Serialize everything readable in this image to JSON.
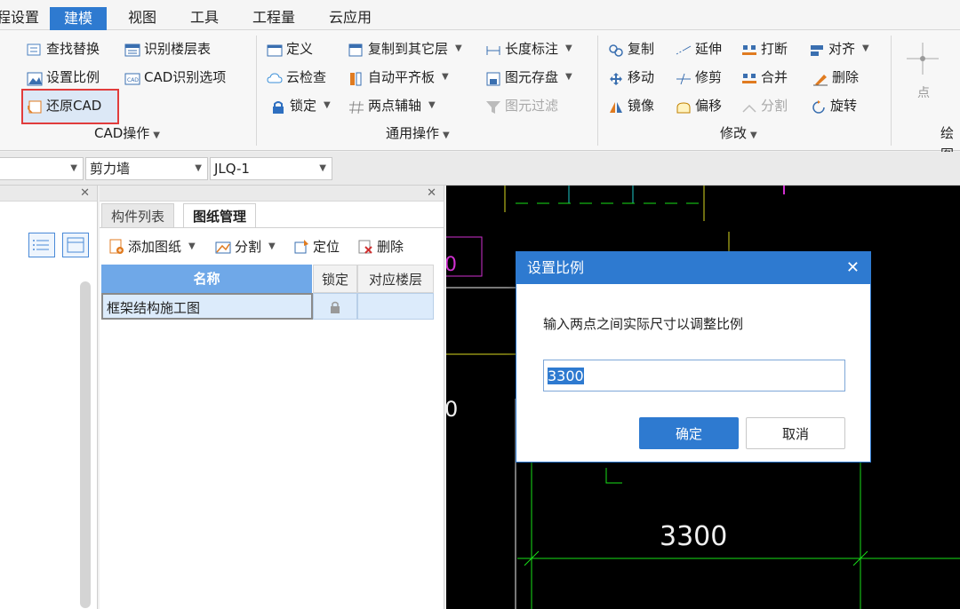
{
  "menu": {
    "tabs": [
      {
        "label": "程设置",
        "active": false
      },
      {
        "label": "建模",
        "active": true
      },
      {
        "label": "视图",
        "active": false
      },
      {
        "label": "工具",
        "active": false
      },
      {
        "label": "工程量",
        "active": false
      },
      {
        "label": "云应用",
        "active": false
      }
    ]
  },
  "ribbon": {
    "cad": {
      "find_replace": "查找替换",
      "identify_floor_table": "识别楼层表",
      "set_scale": "设置比例",
      "cad_identify_options": "CAD识别选项",
      "restore_cad": "还原CAD",
      "group_label": "CAD操作"
    },
    "general": {
      "define": "定义",
      "copy_to_floor": "复制到其它层",
      "length_dim": "长度标注",
      "cloud_check": "云检查",
      "auto_level": "自动平齐板",
      "element_save": "图元存盘",
      "lock": "锁定",
      "two_point_axis": "两点辅轴",
      "element_filter": "图元过滤",
      "group_label": "通用操作"
    },
    "modify": {
      "copy": "复制",
      "extend": "延伸",
      "break": "打断",
      "align": "对齐",
      "move": "移动",
      "trim": "修剪",
      "merge": "合并",
      "delete": "删除",
      "mirror": "镜像",
      "offset": "偏移",
      "split": "分割",
      "rotate": "旋转",
      "group_label": "修改"
    },
    "draw": {
      "point": "点",
      "group_label": "绘图"
    }
  },
  "selectors": {
    "type": "剪力墙",
    "component": "JLQ-1"
  },
  "drawing_panel": {
    "tabs": [
      {
        "label": "构件列表",
        "active": false
      },
      {
        "label": "图纸管理",
        "active": true
      }
    ],
    "toolbar": {
      "add": "添加图纸",
      "split": "分割",
      "locate": "定位",
      "delete": "删除"
    },
    "columns": [
      "名称",
      "锁定",
      "对应楼层"
    ],
    "rows": [
      {
        "name": "框架结构施工图",
        "lock": "locked",
        "floor": ""
      }
    ]
  },
  "cad": {
    "dimension_text": "3300",
    "colors": {
      "green": "#19e019",
      "cyan": "#1ec8c8",
      "magenta": "#d030d0",
      "yellow": "#d8d820",
      "white": "#f0f0f0"
    }
  },
  "dialog": {
    "title": "设置比例",
    "message": "输入两点之间实际尺寸以调整比例",
    "value": "3300",
    "ok": "确定",
    "cancel": "取消"
  },
  "colors": {
    "accent": "#2e7ad0",
    "highlight_border": "#e13c3c",
    "header_blue": "#6fa8e8"
  }
}
